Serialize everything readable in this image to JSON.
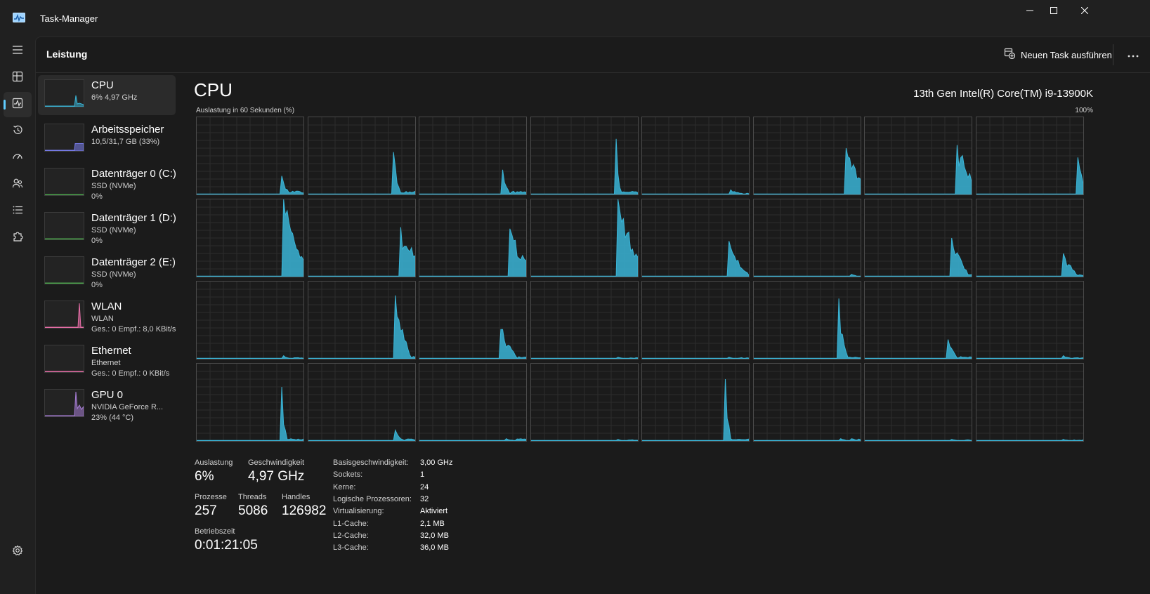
{
  "window": {
    "title": "Task-Manager",
    "icon": "taskmanager-app-icon",
    "controls": [
      "minimize-icon",
      "maximize-icon",
      "close-icon"
    ]
  },
  "nav": {
    "items": [
      {
        "name": "hamburger-menu",
        "icon": "hamburger-icon"
      },
      {
        "name": "processes",
        "icon": "processes-icon"
      },
      {
        "name": "performance",
        "icon": "performance-icon",
        "active": true
      },
      {
        "name": "app-history",
        "icon": "history-icon"
      },
      {
        "name": "startup-apps",
        "icon": "startup-gauge-icon"
      },
      {
        "name": "users",
        "icon": "users-icon"
      },
      {
        "name": "details",
        "icon": "details-list-icon"
      },
      {
        "name": "services",
        "icon": "services-puzzle-icon"
      }
    ],
    "settings_icon": "settings-gear-icon"
  },
  "header": {
    "title": "Leistung",
    "new_task_label": "Neuen Task ausführen",
    "more_icon": "more-ellipsis-icon"
  },
  "resources": [
    {
      "name": "CPU",
      "line1": "6% 4,97 GHz",
      "line2": "",
      "color": "#3ab4d6",
      "active": true
    },
    {
      "name": "Arbeitsspeicher",
      "line1": "10,5/31,7 GB (33%)",
      "line2": "",
      "color": "#7b7ff0",
      "level": 0.33
    },
    {
      "name": "Datenträger 0 (C:)",
      "line1": "SSD (NVMe)",
      "line2": "0%",
      "color": "#4ca64c"
    },
    {
      "name": "Datenträger 1 (D:)",
      "line1": "SSD (NVMe)",
      "line2": "0%",
      "color": "#4ca64c"
    },
    {
      "name": "Datenträger 2 (E:)",
      "line1": "SSD (NVMe)",
      "line2": "0%",
      "color": "#4ca64c"
    },
    {
      "name": "WLAN",
      "line1": "WLAN",
      "line2": "Ges.: 0 Empf.: 8,0 KBit/s",
      "color": "#e86fa8"
    },
    {
      "name": "Ethernet",
      "line1": "Ethernet",
      "line2": "Ges.: 0 Empf.: 0 KBit/s",
      "color": "#e86fa8"
    },
    {
      "name": "GPU 0",
      "line1": "NVIDIA GeForce R...",
      "line2": "23% (44 °C)",
      "color": "#a77dd6"
    }
  ],
  "cpu": {
    "title": "CPU",
    "model": "13th Gen Intel(R) Core(TM) i9-13900K",
    "graph_label": "Auslastung in 60 Sekunden (%)",
    "graph_max": "100%",
    "graph_color": "#3ab4d6",
    "utilization_label": "Auslastung",
    "utilization": "6%",
    "speed_label": "Geschwindigkeit",
    "speed": "4,97 GHz",
    "processes_label": "Prozesse",
    "processes": "257",
    "threads_label": "Threads",
    "threads": "5086",
    "handles_label": "Handles",
    "handles": "126982",
    "uptime_label": "Betriebszeit",
    "uptime": "0:01:21:05",
    "details": [
      {
        "key": "Basisgeschwindigkeit:",
        "value": "3,00 GHz"
      },
      {
        "key": "Sockets:",
        "value": "1"
      },
      {
        "key": "Kerne:",
        "value": "24"
      },
      {
        "key": "Logische Prozessoren:",
        "value": "32"
      },
      {
        "key": "Virtualisierung:",
        "value": "Aktiviert"
      },
      {
        "key": "L1-Cache:",
        "value": "2,1 MB"
      },
      {
        "key": "L2-Cache:",
        "value": "32,0 MB"
      },
      {
        "key": "L3-Cache:",
        "value": "36,0 MB"
      }
    ]
  },
  "chart_data": {
    "type": "area",
    "ylim": [
      0,
      100
    ],
    "grid": true,
    "cores": [
      {
        "base": 3,
        "peak_pos": 0.78,
        "peak": 24,
        "width": 0.1
      },
      {
        "base": 3,
        "peak_pos": 0.79,
        "peak": 55,
        "width": 0.07
      },
      {
        "base": 3,
        "peak_pos": 0.77,
        "peak": 32,
        "width": 0.08
      },
      {
        "base": 3,
        "peak_pos": 0.78,
        "peak": 72,
        "width": 0.06
      },
      {
        "base": 2,
        "peak_pos": 0.82,
        "peak": 6,
        "width": 0.15
      },
      {
        "base": 2,
        "peak_pos": 0.86,
        "peak": 60,
        "width": 0.22
      },
      {
        "base": 2,
        "peak_pos": 0.86,
        "peak": 64,
        "width": 0.26
      },
      {
        "base": 3,
        "peak_pos": 0.94,
        "peak": 48,
        "width": 0.12
      },
      {
        "base": 2,
        "peak_pos": 0.81,
        "peak": 100,
        "width": 0.28
      },
      {
        "base": 2,
        "peak_pos": 0.85,
        "peak": 64,
        "width": 0.3
      },
      {
        "base": 2,
        "peak_pos": 0.84,
        "peak": 62,
        "width": 0.28
      },
      {
        "base": 2,
        "peak_pos": 0.81,
        "peak": 100,
        "width": 0.26
      },
      {
        "base": 2,
        "peak_pos": 0.81,
        "peak": 46,
        "width": 0.2
      },
      {
        "base": 1,
        "peak_pos": 0.9,
        "peak": 3,
        "width": 0.1
      },
      {
        "base": 2,
        "peak_pos": 0.8,
        "peak": 50,
        "width": 0.18
      },
      {
        "base": 2,
        "peak_pos": 0.8,
        "peak": 30,
        "width": 0.16
      },
      {
        "base": 1,
        "peak_pos": 0.8,
        "peak": 4,
        "width": 0.1
      },
      {
        "base": 2,
        "peak_pos": 0.8,
        "peak": 82,
        "width": 0.16
      },
      {
        "base": 2,
        "peak_pos": 0.76,
        "peak": 38,
        "width": 0.16
      },
      {
        "base": 1,
        "peak_pos": 0.8,
        "peak": 2,
        "width": 0.1
      },
      {
        "base": 1,
        "peak_pos": 0.8,
        "peak": 2,
        "width": 0.1
      },
      {
        "base": 2,
        "peak_pos": 0.78,
        "peak": 78,
        "width": 0.1
      },
      {
        "base": 2,
        "peak_pos": 0.77,
        "peak": 25,
        "width": 0.1
      },
      {
        "base": 1,
        "peak_pos": 0.8,
        "peak": 4,
        "width": 0.1
      },
      {
        "base": 2,
        "peak_pos": 0.78,
        "peak": 70,
        "width": 0.07
      },
      {
        "base": 2,
        "peak_pos": 0.8,
        "peak": 14,
        "width": 0.1
      },
      {
        "base": 2,
        "peak_pos": 0.8,
        "peak": 3,
        "width": 0.1
      },
      {
        "base": 1,
        "peak_pos": 0.8,
        "peak": 2,
        "width": 0.1
      },
      {
        "base": 2,
        "peak_pos": 0.77,
        "peak": 80,
        "width": 0.06
      },
      {
        "base": 2,
        "peak_pos": 0.8,
        "peak": 3,
        "width": 0.1
      },
      {
        "base": 1,
        "peak_pos": 0.8,
        "peak": 2,
        "width": 0.1
      },
      {
        "base": 1,
        "peak_pos": 0.8,
        "peak": 2,
        "width": 0.1
      }
    ]
  }
}
